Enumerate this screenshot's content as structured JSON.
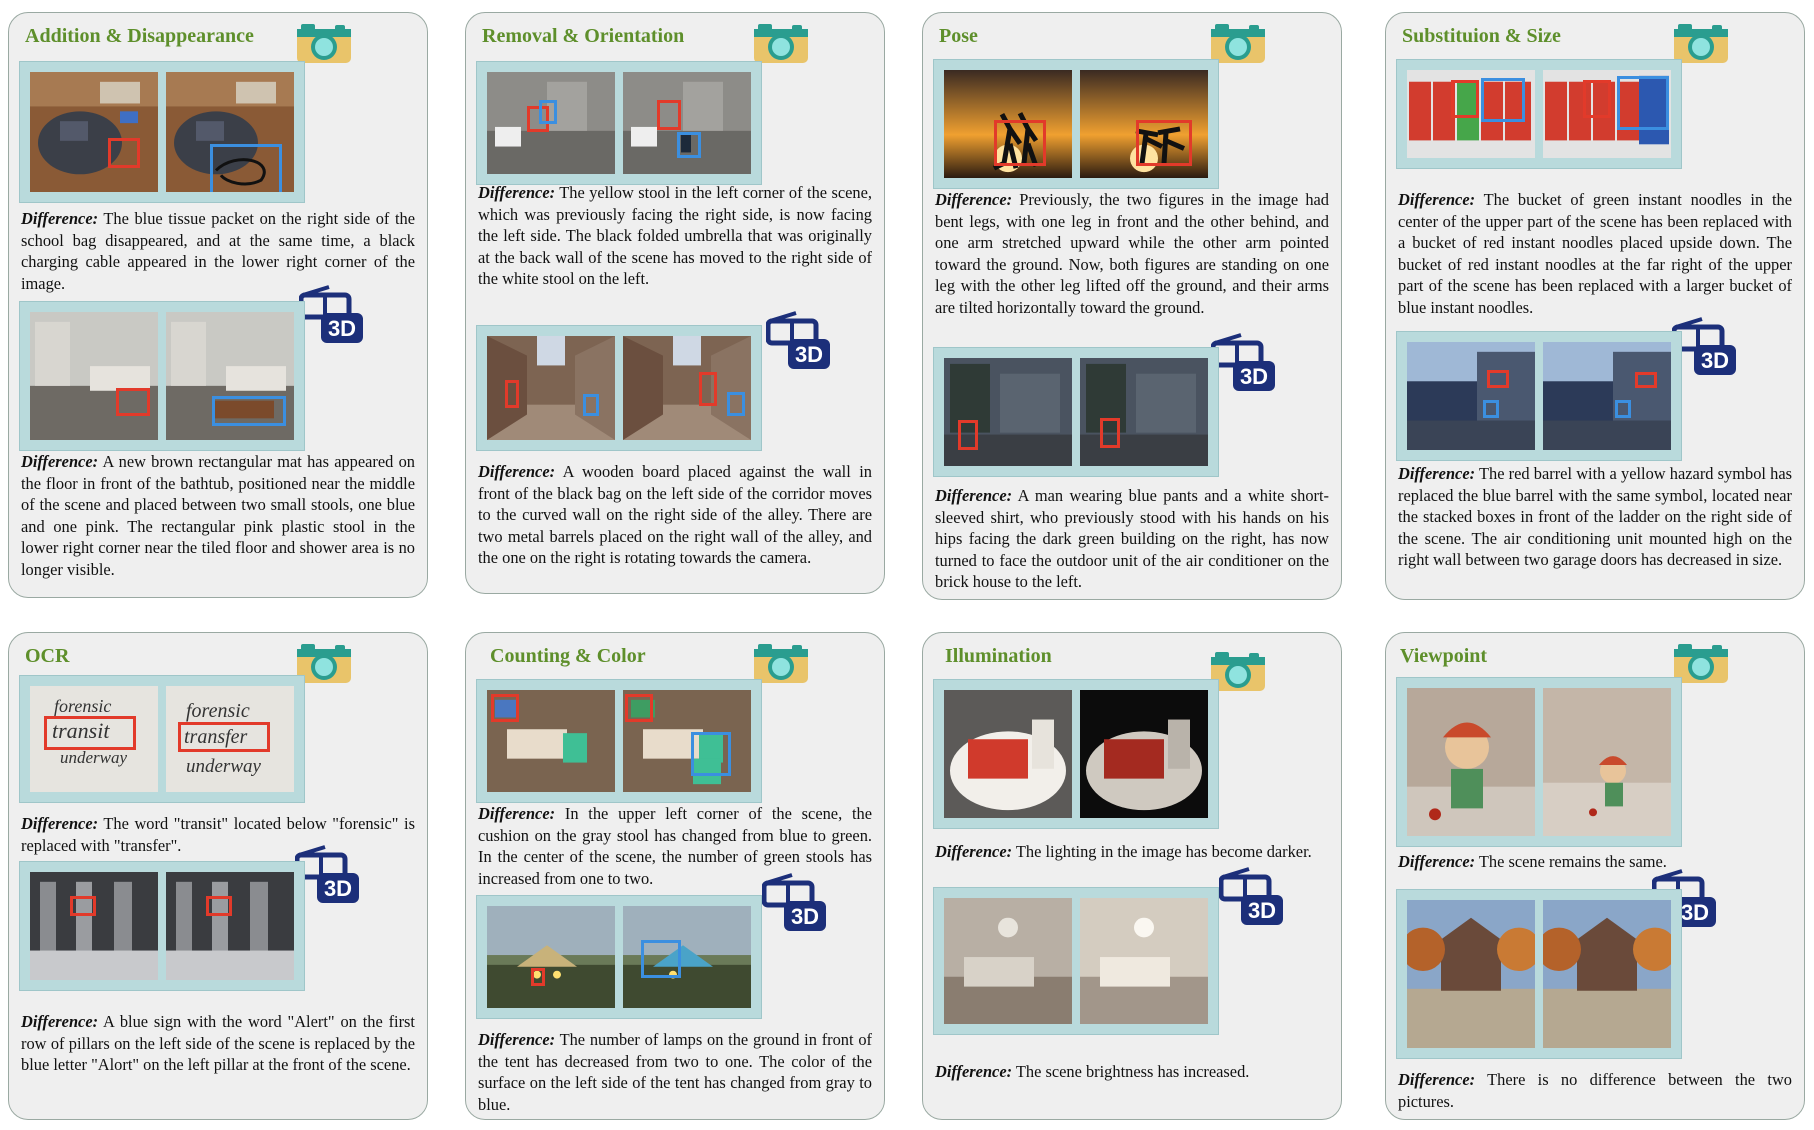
{
  "difference_label": "Difference",
  "three_d_label": "3D",
  "cards": [
    {
      "title": "Addition & Disappearance",
      "pair1_desc": "The blue tissue packet on the right side of the school bag disappeared, and at the same time, a black charging cable appeared in the lower right corner of the image.",
      "pair2_desc": "A new brown rectangular mat has appeared on the floor in front of the bathtub, positioned near the middle of the scene and placed between two small stools, one blue and one pink. The rectangular pink plastic stool in the lower right corner near the tiled floor and shower area is no longer visible."
    },
    {
      "title": "Removal & Orientation",
      "pair1_desc": "The yellow stool in the left corner of the scene, which was previously facing the right side, is now facing the left side. The black folded umbrella that was originally at the back wall of the scene has moved to the right side of the white stool on the left.",
      "pair2_desc": "A wooden board placed against the wall in front of the black bag on the left side of the corridor moves to the curved wall on the right side of the alley. There are two metal barrels placed on the right wall of the alley, and the one on the right is rotating towards the camera."
    },
    {
      "title": "Pose",
      "pair1_desc": "Previously, the two figures in the image had bent legs, with one leg in front and the other behind, and one arm stretched upward while the other arm pointed toward the ground. Now, both figures are standing on one leg with the other leg lifted off the ground, and their arms are tilted horizontally toward the ground.",
      "pair2_desc": "A man wearing blue pants and a white short-sleeved shirt, who previously stood with his hands on his hips facing the dark green building on the right, has now turned to face the outdoor unit of the air conditioner on the brick house to the left."
    },
    {
      "title": "Substituion & Size",
      "pair1_desc": "The bucket of green instant noodles in the center of the upper part of the scene has been replaced with a bucket of red instant noodles placed upside down. The bucket of red instant noodles at the far right of the upper part of the scene has been replaced with a larger bucket of blue instant noodles.",
      "pair2_desc": "The red barrel with a yellow hazard symbol has replaced the blue barrel with the same symbol, located near the stacked boxes in front of the ladder on the right side of the scene. The air conditioning unit mounted high on the right wall between two garage doors has decreased in size."
    },
    {
      "title": "OCR",
      "pair1_desc": "The word \"transit\" located below \"forensic\" is replaced with \"transfer\".",
      "pair2_desc": "A blue sign with the word \"Alert\" on the first row of pillars on the left side of the scene is replaced by the blue letter \"Alort\" on the left pillar at the front of the scene.",
      "handwriting_left": [
        "forensic",
        "transit",
        "underway"
      ],
      "handwriting_right": [
        "forensic",
        "transfer",
        "underway"
      ]
    },
    {
      "title": "Counting & Color",
      "pair1_desc": "In the upper left corner of the scene, the cushion on the gray stool has changed from blue to green. In the center of the scene, the number of green stools has increased from one to two.",
      "pair2_desc": "The number of lamps on the ground in front of the tent has decreased from two to one.  The color of the surface on the left side of the tent has changed from gray to blue."
    },
    {
      "title": "Illumination",
      "pair1_desc": "The lighting in the image has become darker.",
      "pair2_desc": "The scene brightness has increased."
    },
    {
      "title": "Viewpoint",
      "pair1_desc": "The scene remains the same.",
      "pair2_desc": "There is no difference between the two pictures."
    }
  ]
}
